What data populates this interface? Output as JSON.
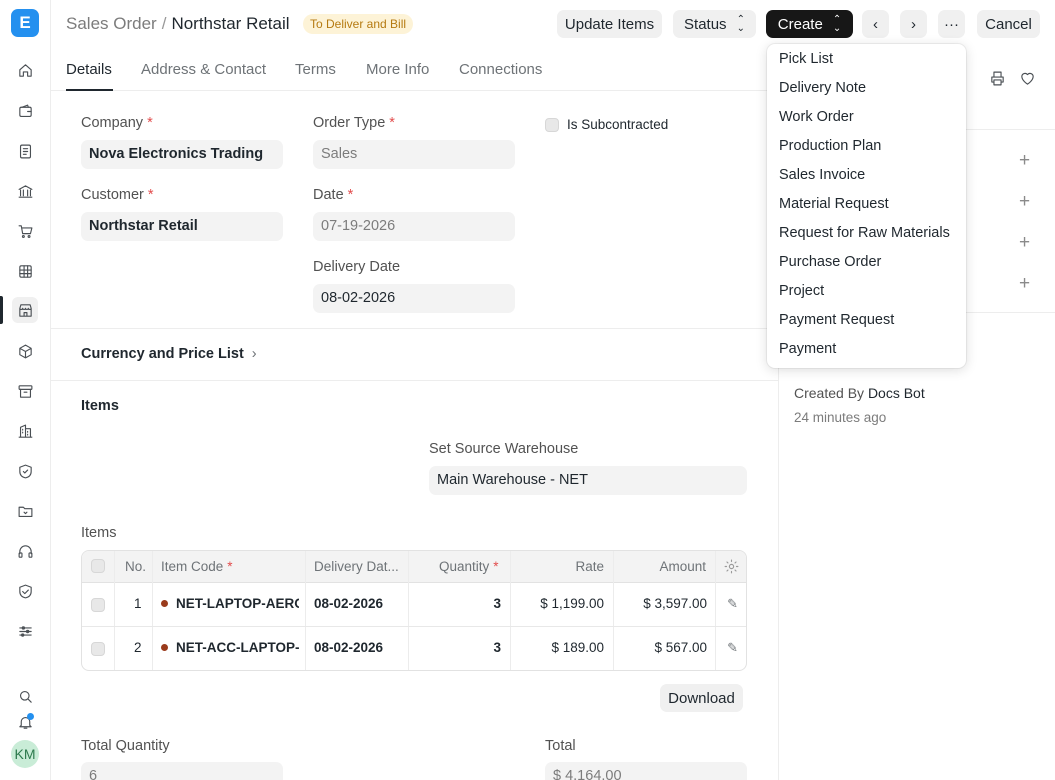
{
  "app": {
    "logo_letter": "E",
    "avatar_initials": "KM"
  },
  "sidebar": {
    "icons": [
      "home-icon",
      "wallet-icon",
      "document-icon",
      "bank-icon",
      "cart-icon",
      "table-icon",
      "store-icon",
      "box-icon",
      "archive-icon",
      "building-icon",
      "shield-icon",
      "folder-icon",
      "headset-icon",
      "handshake-icon",
      "sliders-icon"
    ],
    "active": "store-icon"
  },
  "header": {
    "breadcrumb_root": "Sales Order",
    "breadcrumb_separator": "/",
    "title": "Northstar Retail",
    "status": "To Deliver and Bill",
    "update_items": "Update Items",
    "status_btn": "Status",
    "create_btn": "Create",
    "more": "···",
    "cancel": "Cancel"
  },
  "tabs": [
    "Details",
    "Address & Contact",
    "Terms",
    "More Info",
    "Connections"
  ],
  "form": {
    "company_label": "Company",
    "company_value": "Nova Electronics Trading",
    "order_type_label": "Order Type",
    "order_type_value": "Sales",
    "is_subcontracted_label": "Is Subcontracted",
    "customer_label": "Customer",
    "customer_value": "Northstar Retail",
    "date_label": "Date",
    "date_value": "07-19-2026",
    "delivery_date_label": "Delivery Date",
    "delivery_date_value": "08-02-2026",
    "currency_section": "Currency and Price List",
    "items_section": "Items",
    "source_warehouse_label": "Set Source Warehouse",
    "source_warehouse_value": "Main Warehouse - NET",
    "items_table_label": "Items",
    "total_qty_label": "Total Quantity",
    "total_qty_value": "6",
    "total_label": "Total",
    "total_value": "$ 4,164.00",
    "download": "Download"
  },
  "items_table": {
    "headers": {
      "no": "No.",
      "item_code": "Item Code",
      "delivery_date": "Delivery Dat...",
      "quantity": "Quantity",
      "rate": "Rate",
      "amount": "Amount"
    },
    "rows": [
      {
        "no": "1",
        "item_code": "NET-LAPTOP-AERO",
        "delivery_date": "08-02-2026",
        "quantity": "3",
        "rate": "$ 1,199.00",
        "amount": "$ 3,597.00"
      },
      {
        "no": "2",
        "item_code": "NET-ACC-LAPTOP-",
        "delivery_date": "08-02-2026",
        "quantity": "3",
        "rate": "$ 189.00",
        "amount": "$ 567.00"
      }
    ]
  },
  "create_menu": [
    "Pick List",
    "Delivery Note",
    "Work Order",
    "Production Plan",
    "Sales Invoice",
    "Material Request",
    "Request for Raw Materials",
    "Purchase Order",
    "Project",
    "Payment Request",
    "Payment"
  ],
  "activity": {
    "created_by_prefix": "Created By",
    "created_by_name": "Docs Bot",
    "time": "24 minutes ago"
  },
  "colors": {
    "accent": "#2490ef",
    "status_bg": "#fdf3d7",
    "status_text": "#b57a11",
    "create_bg": "#171717"
  }
}
